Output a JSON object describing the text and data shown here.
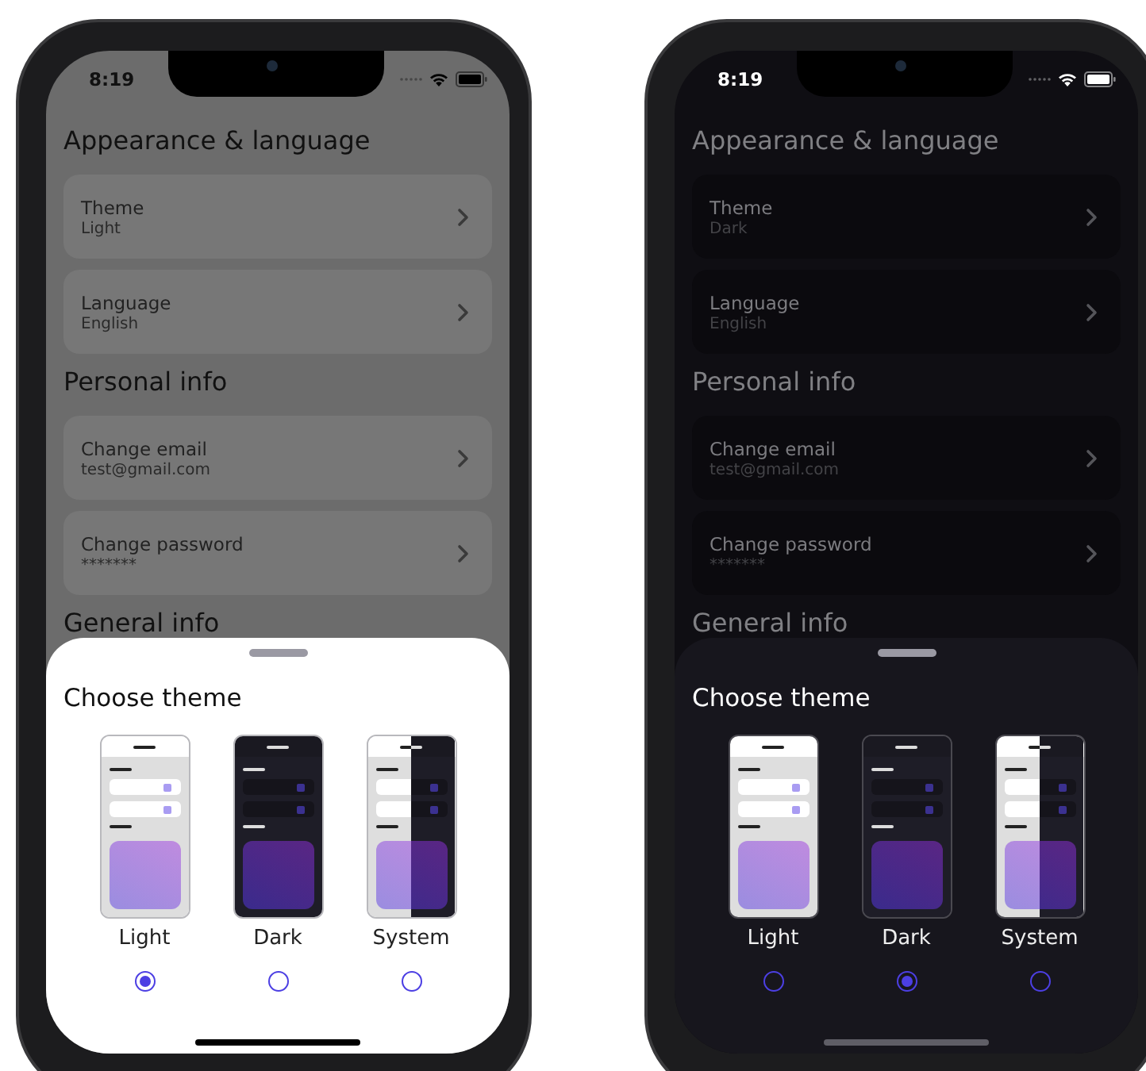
{
  "phones": [
    {
      "kind": "light",
      "status_time": "8:19",
      "sections": [
        {
          "title": "Appearance & language",
          "items": [
            {
              "label": "Theme",
              "value": "Light"
            },
            {
              "label": "Language",
              "value": "English"
            }
          ]
        },
        {
          "title": "Personal info",
          "items": [
            {
              "label": "Change email",
              "value": "test@gmail.com"
            },
            {
              "label": "Change password",
              "value": "*******"
            }
          ]
        },
        {
          "title": "General info"
        }
      ],
      "sheet": {
        "title": "Choose theme",
        "options": [
          {
            "kind": "light",
            "label": "Light",
            "selected": true
          },
          {
            "kind": "dark",
            "label": "Dark",
            "selected": false
          },
          {
            "kind": "system",
            "label": "System",
            "selected": false
          }
        ]
      }
    },
    {
      "kind": "dark",
      "status_time": "8:19",
      "sections": [
        {
          "title": "Appearance & language",
          "items": [
            {
              "label": "Theme",
              "value": "Dark"
            },
            {
              "label": "Language",
              "value": "English"
            }
          ]
        },
        {
          "title": "Personal info",
          "items": [
            {
              "label": "Change email",
              "value": "test@gmail.com"
            },
            {
              "label": "Change password",
              "value": "*******"
            }
          ]
        },
        {
          "title": "General info"
        }
      ],
      "sheet": {
        "title": "Choose theme",
        "options": [
          {
            "kind": "light",
            "label": "Light",
            "selected": false
          },
          {
            "kind": "dark",
            "label": "Dark",
            "selected": true
          },
          {
            "kind": "system",
            "label": "System",
            "selected": false
          }
        ]
      }
    }
  ]
}
